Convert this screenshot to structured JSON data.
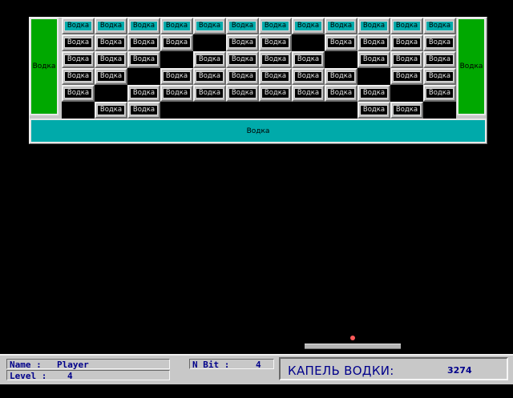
{
  "game": {
    "side_left_label": "Водка",
    "side_right_label": "Водка",
    "bottom_bar_label": "Водка",
    "brick_label": "Водка",
    "brick_rows": [
      [
        "teal",
        "teal",
        "teal",
        "teal",
        "teal",
        "teal",
        "teal",
        "teal",
        "teal",
        "teal",
        "teal",
        "teal"
      ],
      [
        "grey",
        "grey",
        "grey",
        "grey",
        null,
        "grey",
        "grey",
        null,
        "grey",
        "grey",
        "grey",
        "grey"
      ],
      [
        "grey",
        "grey",
        "grey",
        null,
        "grey",
        "grey",
        "grey",
        "grey",
        null,
        "grey",
        "grey",
        "grey"
      ],
      [
        "grey",
        "grey",
        null,
        "grey",
        "grey",
        "grey",
        "grey",
        "grey",
        "grey",
        null,
        "grey",
        "grey"
      ],
      [
        "grey",
        null,
        "grey",
        "grey",
        "grey",
        "grey",
        "grey",
        "grey",
        "grey",
        "grey",
        null,
        "grey"
      ],
      [
        null,
        "grey",
        "grey",
        null,
        null,
        null,
        null,
        null,
        null,
        "grey",
        "grey",
        null
      ]
    ],
    "ball_color": "#ff5a5a",
    "brick_teal_color": "#00aaaa",
    "side_green_color": "#00a800"
  },
  "status": {
    "name_label": "Name : ",
    "name_value": "Player",
    "level_label": "Level : ",
    "level_value": "4",
    "nbit_label": "N Bit : ",
    "nbit_value": "4",
    "score_label": "КАПЕЛЬ ВОДКИ:",
    "score_value": "3274"
  }
}
